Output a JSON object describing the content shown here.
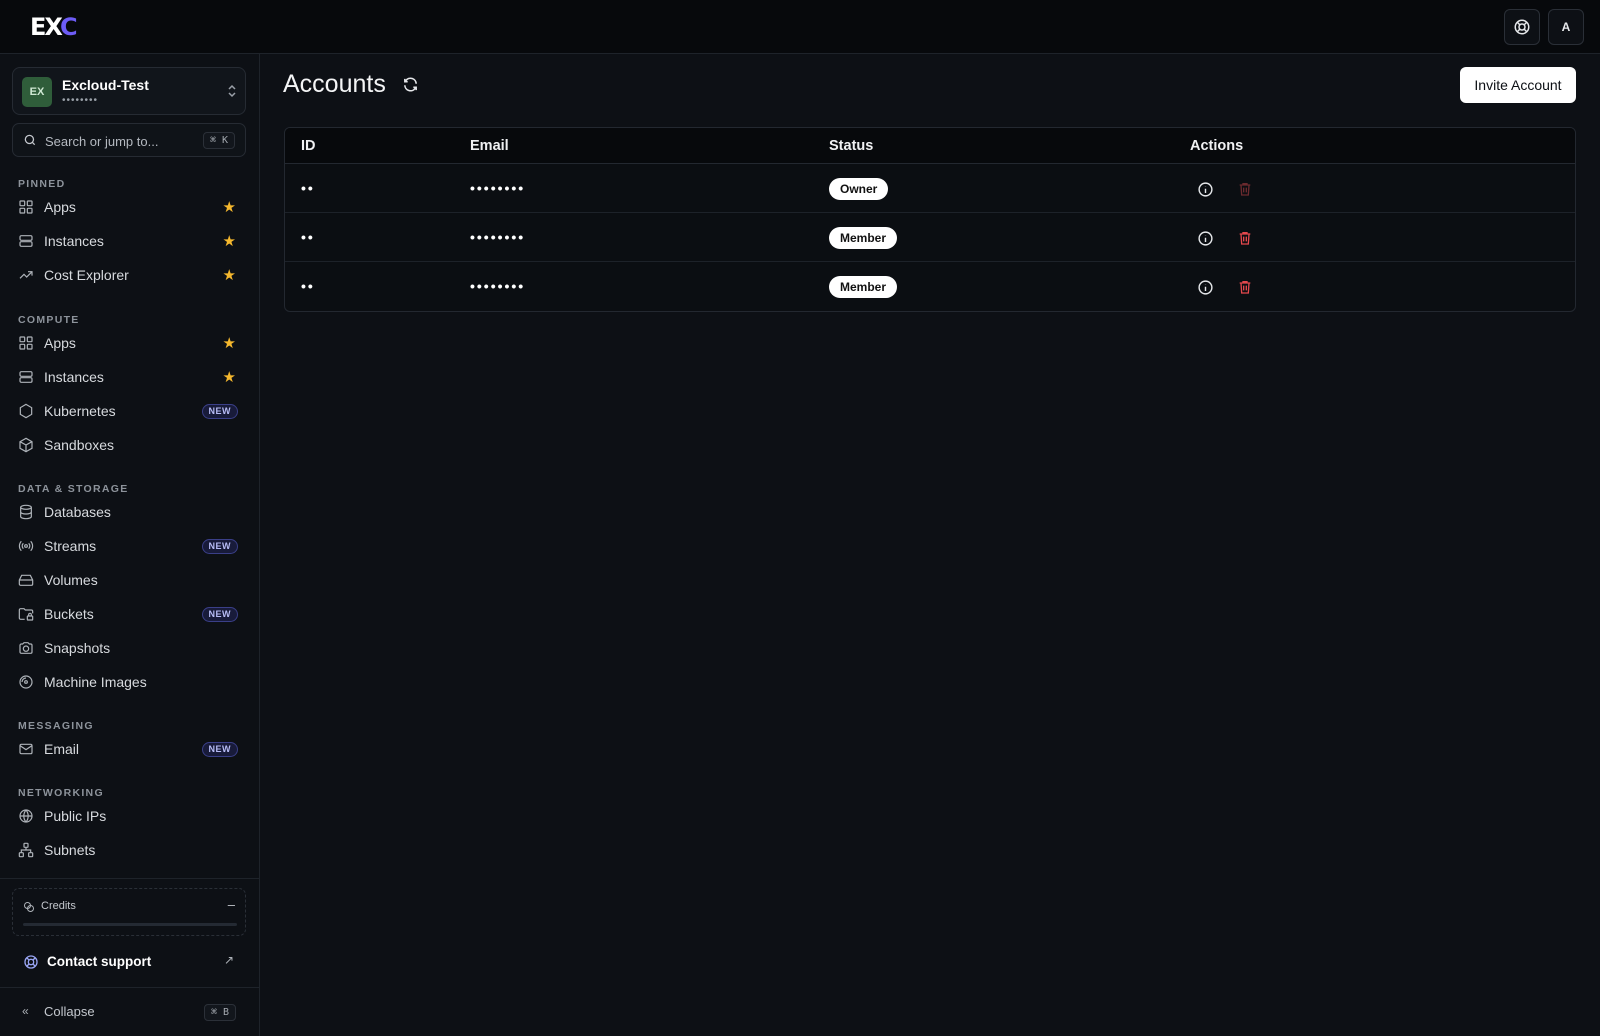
{
  "brand": {
    "logo_main": "EX",
    "logo_accent": "C"
  },
  "topbar": {
    "help_icon": "lifebuoy-icon",
    "avatar_initial": "A"
  },
  "org": {
    "initials": "EX",
    "name": "Excloud-Test",
    "sub": "••••••••"
  },
  "search": {
    "placeholder": "Search or jump to...",
    "shortcut": "⌘ K"
  },
  "sections": {
    "pinned": "PINNED",
    "compute": "COMPUTE",
    "data_storage": "DATA & STORAGE",
    "messaging": "MESSAGING",
    "networking": "NETWORKING"
  },
  "nav": {
    "pinned": [
      {
        "label": "Apps",
        "icon": "grid-icon",
        "starred": true
      },
      {
        "label": "Instances",
        "icon": "server-icon",
        "starred": true
      },
      {
        "label": "Cost Explorer",
        "icon": "trending-up-icon",
        "starred": true
      }
    ],
    "compute": [
      {
        "label": "Apps",
        "icon": "grid-icon",
        "starred": true
      },
      {
        "label": "Instances",
        "icon": "server-icon",
        "starred": true
      },
      {
        "label": "Kubernetes",
        "icon": "hexagon-icon",
        "badge": "NEW"
      },
      {
        "label": "Sandboxes",
        "icon": "box-icon"
      }
    ],
    "data_storage": [
      {
        "label": "Databases",
        "icon": "database-icon"
      },
      {
        "label": "Streams",
        "icon": "radio-icon",
        "badge": "NEW"
      },
      {
        "label": "Volumes",
        "icon": "hard-drive-icon"
      },
      {
        "label": "Buckets",
        "icon": "folder-lock-icon",
        "badge": "NEW"
      },
      {
        "label": "Snapshots",
        "icon": "camera-icon"
      },
      {
        "label": "Machine Images",
        "icon": "disc-icon"
      }
    ],
    "messaging": [
      {
        "label": "Email",
        "icon": "mail-icon",
        "badge": "NEW"
      }
    ],
    "networking": [
      {
        "label": "Public IPs",
        "icon": "globe-icon"
      },
      {
        "label": "Subnets",
        "icon": "network-icon"
      }
    ]
  },
  "credits": {
    "label": "Credits",
    "value": "–",
    "progress": 0
  },
  "support": {
    "label": "Contact support"
  },
  "collapse": {
    "label": "Collapse",
    "shortcut": "⌘ B"
  },
  "page": {
    "title": "Accounts",
    "invite_label": "Invite Account"
  },
  "table": {
    "headers": {
      "id": "ID",
      "email": "Email",
      "status": "Status",
      "actions": "Actions"
    },
    "rows": [
      {
        "id": "••",
        "email": "••••••••",
        "status": "Owner",
        "delete_enabled": false
      },
      {
        "id": "••",
        "email": "••••••••",
        "status": "Member",
        "delete_enabled": true
      },
      {
        "id": "••",
        "email": "••••••••",
        "status": "Member",
        "delete_enabled": true
      }
    ]
  },
  "colors": {
    "accent": "#6d5cf6",
    "star": "#f5b82e",
    "danger": "#e5484d",
    "danger_muted": "#6b2a2e"
  }
}
